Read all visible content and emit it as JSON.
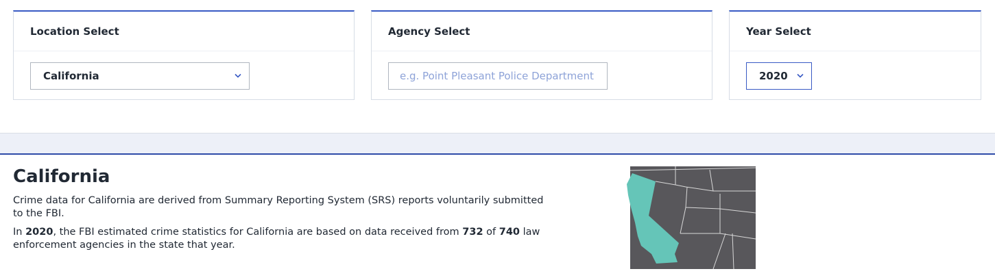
{
  "location_card": {
    "title": "Location Select",
    "selected": "California"
  },
  "agency_card": {
    "title": "Agency Select",
    "placeholder": "e.g. Point Pleasant Police Department"
  },
  "year_card": {
    "title": "Year Select",
    "selected": "2020"
  },
  "summary": {
    "title": "California",
    "intro": "Crime data for California are derived from Summary Reporting System (SRS) reports voluntarily submitted to the FBI.",
    "estimate_prefix": "In ",
    "year": "2020",
    "estimate_mid": ", the FBI estimated crime statistics for California are based on data received from ",
    "agencies_reporting": "732",
    "of_word": " of ",
    "agencies_total": "740",
    "estimate_suffix": " law enforcement agencies in the state that year."
  },
  "map": {
    "highlight_color": "#65c5b8",
    "land_color": "#58575b",
    "border_color": "#d8d8d8",
    "icon": "state-map"
  },
  "colors": {
    "accent": "#3859c4",
    "band": "#edf0f8"
  }
}
